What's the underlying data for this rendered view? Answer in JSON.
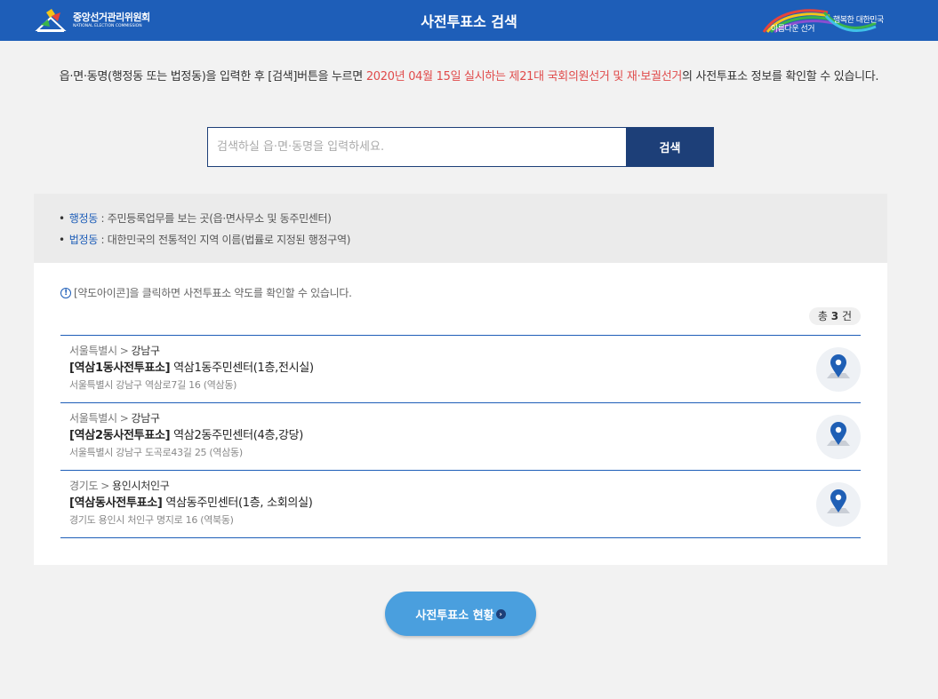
{
  "header": {
    "logo_ko": "중앙선거관리위원회",
    "logo_en": "NATIONAL ELECTION COMMISSION",
    "title": "사전투표소 검색",
    "slogan_left": "아름다운 선거",
    "slogan_right": "행복한 대한민국",
    "bg_color": "#1e5eb8"
  },
  "intro": {
    "before": "읍·면·동명(행정동 또는 법정동)을 입력한 후 [검색]버튼을 누르면 ",
    "highlight": "2020년 04월 15일 실시하는 제21대 국회의원선거 및 재·보궐선거",
    "after": "의 사전투표소 정보를 확인할 수 있습니다.",
    "highlight_color": "#e04b4b"
  },
  "search": {
    "placeholder": "검색하실 읍·면·동명을 입력하세요.",
    "value": "",
    "button_label": "검색"
  },
  "guide": {
    "items": [
      {
        "term": "행정동",
        "desc": " : 주민등록업무를 보는 곳(읍·면사무소 및 동주민센터)"
      },
      {
        "term": "법정동",
        "desc": " : 대한민국의 전통적인 지역 이름(법률로 지정된 행정구역)"
      }
    ]
  },
  "results": {
    "notice": "[약도아이콘]을 클릭하면 사전투표소 약도를 확인할 수 있습니다.",
    "count_prefix": "총 ",
    "count": "3",
    "count_suffix": " 건",
    "items": [
      {
        "region": "서울특별시",
        "district": "강남구",
        "name": "[역삼1동사전투표소]",
        "place": " 역삼1동주민센터(1층,전시실)",
        "address": "서울특별시 강남구 역삼로7길 16 (역삼동)"
      },
      {
        "region": "서울특별시",
        "district": "강남구",
        "name": "[역삼2동사전투표소]",
        "place": " 역삼2동주민센터(4층,강당)",
        "address": "서울특별시 강남구 도곡로43길 25 (역삼동)"
      },
      {
        "region": "경기도",
        "district": "용인시처인구",
        "name": "[역삼동사전투표소]",
        "place": " 역삼동주민센터(1층, 소회의실)",
        "address": "경기도 용인시 처인구 명지로 16 (역북동)"
      }
    ]
  },
  "footer": {
    "status_button": "사전투표소 현황"
  },
  "icons": {
    "info": "info-icon",
    "map": "map-pin-icon",
    "arrow": "chevron-right-icon"
  }
}
